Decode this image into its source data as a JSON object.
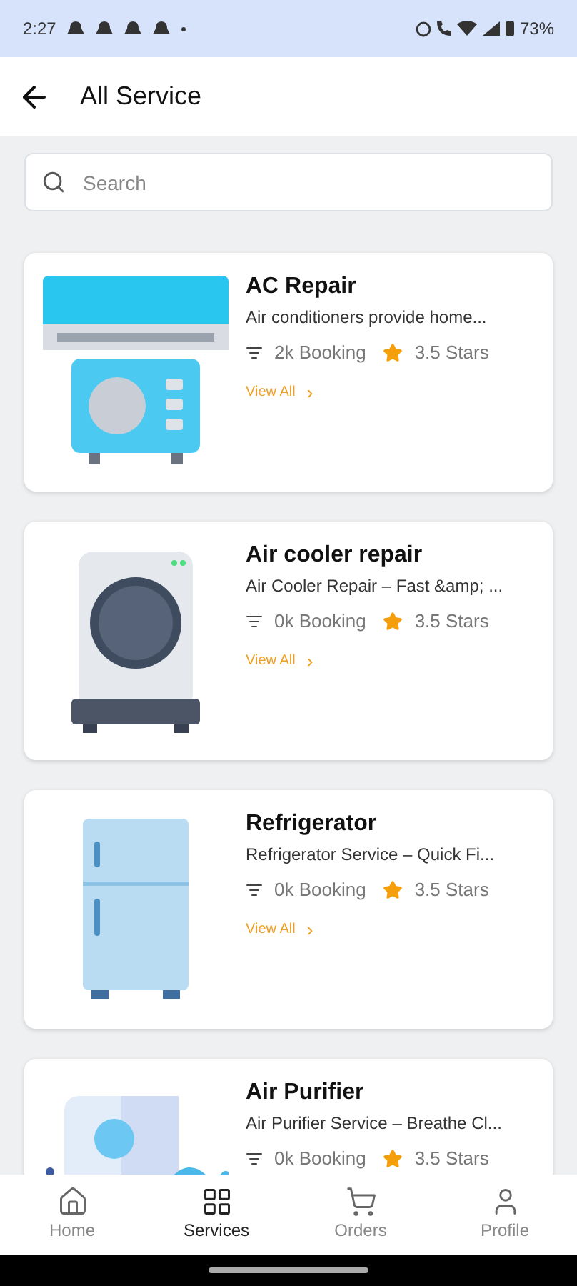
{
  "status_bar": {
    "time": "2:27",
    "battery": "73%"
  },
  "header": {
    "title": "All Service"
  },
  "search": {
    "placeholder": "Search"
  },
  "services": [
    {
      "title": "AC Repair",
      "description": "Air conditioners provide home...",
      "bookings": "2k Booking",
      "rating": "3.5 Stars",
      "link": "View All",
      "chevron": "›"
    },
    {
      "title": "Air cooler repair",
      "description": "Air Cooler Repair – Fast &amp; ...",
      "bookings": "0k Booking",
      "rating": "3.5 Stars",
      "link": "View All",
      "chevron": "›"
    },
    {
      "title": "Refrigerator",
      "description": "Refrigerator Service – Quick Fi...",
      "bookings": "0k Booking",
      "rating": "3.5 Stars",
      "link": "View All",
      "chevron": "›"
    },
    {
      "title": "Air Purifier",
      "description": "Air Purifier Service – Breathe Cl...",
      "bookings": "0k Booking",
      "rating": "3.5 Stars"
    }
  ],
  "nav": [
    {
      "label": "Home",
      "selected": false
    },
    {
      "label": "Services",
      "selected": true
    },
    {
      "label": "Orders",
      "selected": false
    },
    {
      "label": "Profile",
      "selected": false
    }
  ]
}
